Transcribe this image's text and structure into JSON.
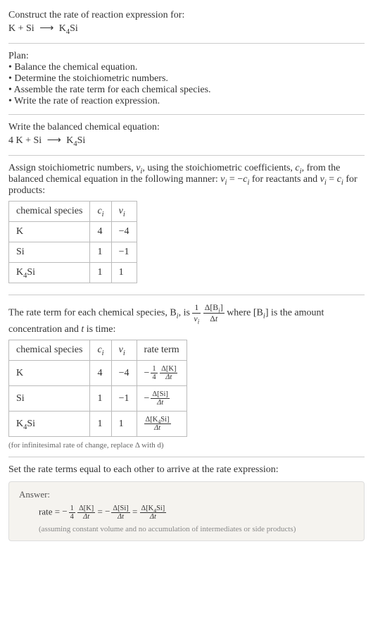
{
  "problem": {
    "prompt": "Construct the rate of reaction expression for:",
    "equation_lhs": "K + Si",
    "equation_rhs": "K",
    "equation_rhs_sub": "4",
    "equation_rhs_tail": "Si"
  },
  "plan": {
    "heading": "Plan:",
    "items": [
      "Balance the chemical equation.",
      "Determine the stoichiometric numbers.",
      "Assemble the rate term for each chemical species.",
      "Write the rate of reaction expression."
    ]
  },
  "balanced": {
    "heading": "Write the balanced chemical equation:",
    "lhs": "4 K + Si",
    "rhs": "K",
    "rhs_sub": "4",
    "rhs_tail": "Si"
  },
  "stoich": {
    "text1": "Assign stoichiometric numbers, ",
    "nu": "ν",
    "sub_i": "i",
    "text2": ", using the stoichiometric coefficients, ",
    "c": "c",
    "text3": ", from the balanced chemical equation in the following manner: ",
    "rel1": "ν",
    "rel1_eq": " = −",
    "rel1_rhs": "c",
    "text4": " for reactants and ",
    "rel2_eq": " = ",
    "text5": " for products:",
    "table_headers": [
      "chemical species",
      "c",
      "ν"
    ],
    "table_rows": [
      {
        "species": "K",
        "c": "4",
        "nu": "−4"
      },
      {
        "species": "Si",
        "c": "1",
        "nu": "−1"
      },
      {
        "species_pre": "K",
        "species_sub": "4",
        "species_post": "Si",
        "c": "1",
        "nu": "1"
      }
    ]
  },
  "rate_terms": {
    "text1": "The rate term for each chemical species, B",
    "text2": ", is ",
    "text3": " where [B",
    "text4": "] is the amount concentration and ",
    "t": "t",
    "text5": " is time:",
    "frac1_num": "1",
    "frac1_den_sym": "ν",
    "frac2_num_pre": "Δ[B",
    "frac2_num_post": "]",
    "frac2_den_pre": "Δ",
    "table_headers": [
      "chemical species",
      "c",
      "ν",
      "rate term"
    ],
    "table_rows": [
      {
        "species": "K",
        "c": "4",
        "nu": "−4",
        "minus": "−",
        "coef_num": "1",
        "coef_den": "4",
        "delta_num": "Δ[K]",
        "delta_den": "Δt"
      },
      {
        "species": "Si",
        "c": "1",
        "nu": "−1",
        "minus": "−",
        "delta_num": "Δ[Si]",
        "delta_den": "Δt"
      },
      {
        "species_pre": "K",
        "species_sub": "4",
        "species_post": "Si",
        "c": "1",
        "nu": "1",
        "delta_num_pre": "Δ[K",
        "delta_num_sub": "4",
        "delta_num_post": "Si]",
        "delta_den": "Δt"
      }
    ],
    "note": "(for infinitesimal rate of change, replace Δ with d)"
  },
  "conclusion": {
    "text": "Set the rate terms equal to each other to arrive at the rate expression:"
  },
  "answer": {
    "label": "Answer:",
    "rate_label": "rate = ",
    "minus": "−",
    "t1_coef_num": "1",
    "t1_coef_den": "4",
    "t1_num": "Δ[K]",
    "t1_den": "Δt",
    "eq": " = ",
    "t2_num": "Δ[Si]",
    "t2_den": "Δt",
    "t3_num_pre": "Δ[K",
    "t3_num_sub": "4",
    "t3_num_post": "Si]",
    "t3_den": "Δt",
    "note": "(assuming constant volume and no accumulation of intermediates or side products)"
  }
}
